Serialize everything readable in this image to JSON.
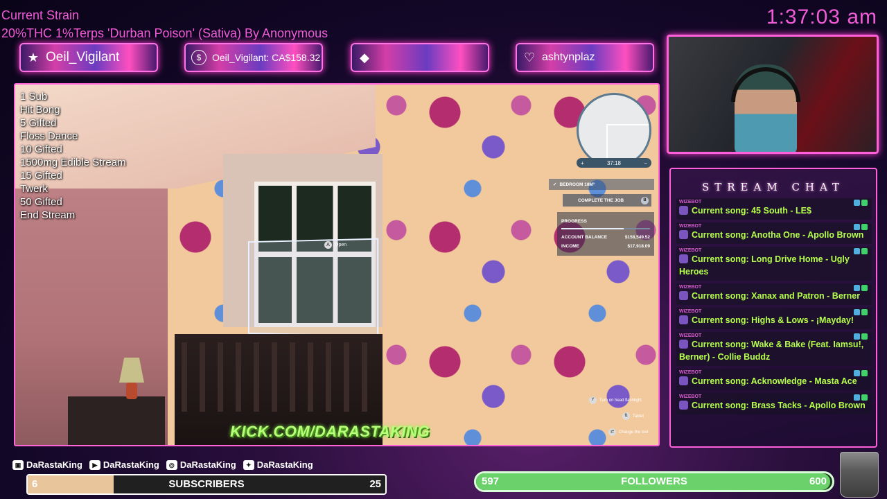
{
  "header": {
    "strain_title": "Current Strain",
    "strain_desc": "20%THC 1%Terps 'Durban Poison' (Sativa) By Anonymous",
    "clock": "1:37:03 am"
  },
  "alerts": [
    {
      "icon": "star-icon",
      "glyph": "★",
      "text": "Oeil_Vigilant"
    },
    {
      "icon": "dollar-icon",
      "glyph": "$",
      "text": "Oeil_Vigilant: CA$158.32"
    },
    {
      "icon": "diamond-icon",
      "glyph": "◆",
      "text": ""
    },
    {
      "icon": "heart-icon",
      "glyph": "♡",
      "text": "ashtynplaz"
    }
  ],
  "goals": [
    "1 Sub",
    "Hit Bong",
    "5 Gifted",
    "Floss Dance",
    "10 Gifted",
    "1500mg Edible Stream",
    "15 Gifted",
    "Twerk",
    "50 Gifted",
    "End Stream"
  ],
  "game": {
    "map_time": "37:18",
    "map_plus": "+",
    "map_minus": "−",
    "open_key": "A",
    "open_label": "Open",
    "job": {
      "room": "BEDROOM 18M²",
      "complete_label": "COMPLETE THE JOB",
      "complete_key": "B",
      "progress_label": "PROGRESS",
      "progress_fraction": 0.7,
      "account_label": "ACCOUNT BALANCE",
      "account_value": "$158,549.52",
      "income_label": "INCOME",
      "income_value": "$17,918.09"
    },
    "hints": [
      {
        "key": "Y",
        "label": "Turn on head flashlight"
      },
      {
        "key": "⇅",
        "label": "Tablet"
      },
      {
        "key": "⇄",
        "label": "Change the tool"
      }
    ],
    "kick_url": "KICK.COM/DARASTAKING"
  },
  "chat": {
    "title": "STREAM CHAT",
    "messages": [
      {
        "author": "WIZEBOT",
        "text": "Current song: 45 South - LE$"
      },
      {
        "author": "WIZEBOT",
        "text": "Current song: Anotha One - Apollo Brown"
      },
      {
        "author": "WIZEBOT",
        "text": "Current song: Long Drive Home - Ugly Heroes"
      },
      {
        "author": "WIZEBOT",
        "text": "Current song: Xanax and Patron - Berner"
      },
      {
        "author": "WIZEBOT",
        "text": "Current song: Highs & Lows - ¡Mayday!"
      },
      {
        "author": "WIZEBOT",
        "text": "Current song: Wake & Bake (Feat. Iamsu!, Berner) - Collie Buddz"
      },
      {
        "author": "WIZEBOT",
        "text": "Current song: Acknowledge - Masta Ace"
      },
      {
        "author": "WIZEBOT",
        "text": "Current song: Brass Tacks - Apollo Brown"
      }
    ]
  },
  "socials": [
    {
      "icon": "twitch-icon",
      "glyph": "▣",
      "handle": "DaRastaKing"
    },
    {
      "icon": "youtube-icon",
      "glyph": "▶",
      "handle": "DaRastaKing"
    },
    {
      "icon": "instagram-icon",
      "glyph": "◎",
      "handle": "DaRastaKing"
    },
    {
      "icon": "twitter-icon",
      "glyph": "✦",
      "handle": "DaRastaKing"
    }
  ],
  "subs_bar": {
    "current": "6",
    "label": "SUBSCRIBERS",
    "goal": "25",
    "fraction": 0.24
  },
  "followers_bar": {
    "current": "597",
    "label": "FOLLOWERS",
    "goal": "600",
    "fraction": 0.995
  },
  "colors": {
    "accent_pink": "#f05bd6",
    "chat_text": "#b5ff4a",
    "kick_green": "#b8ff7a"
  }
}
